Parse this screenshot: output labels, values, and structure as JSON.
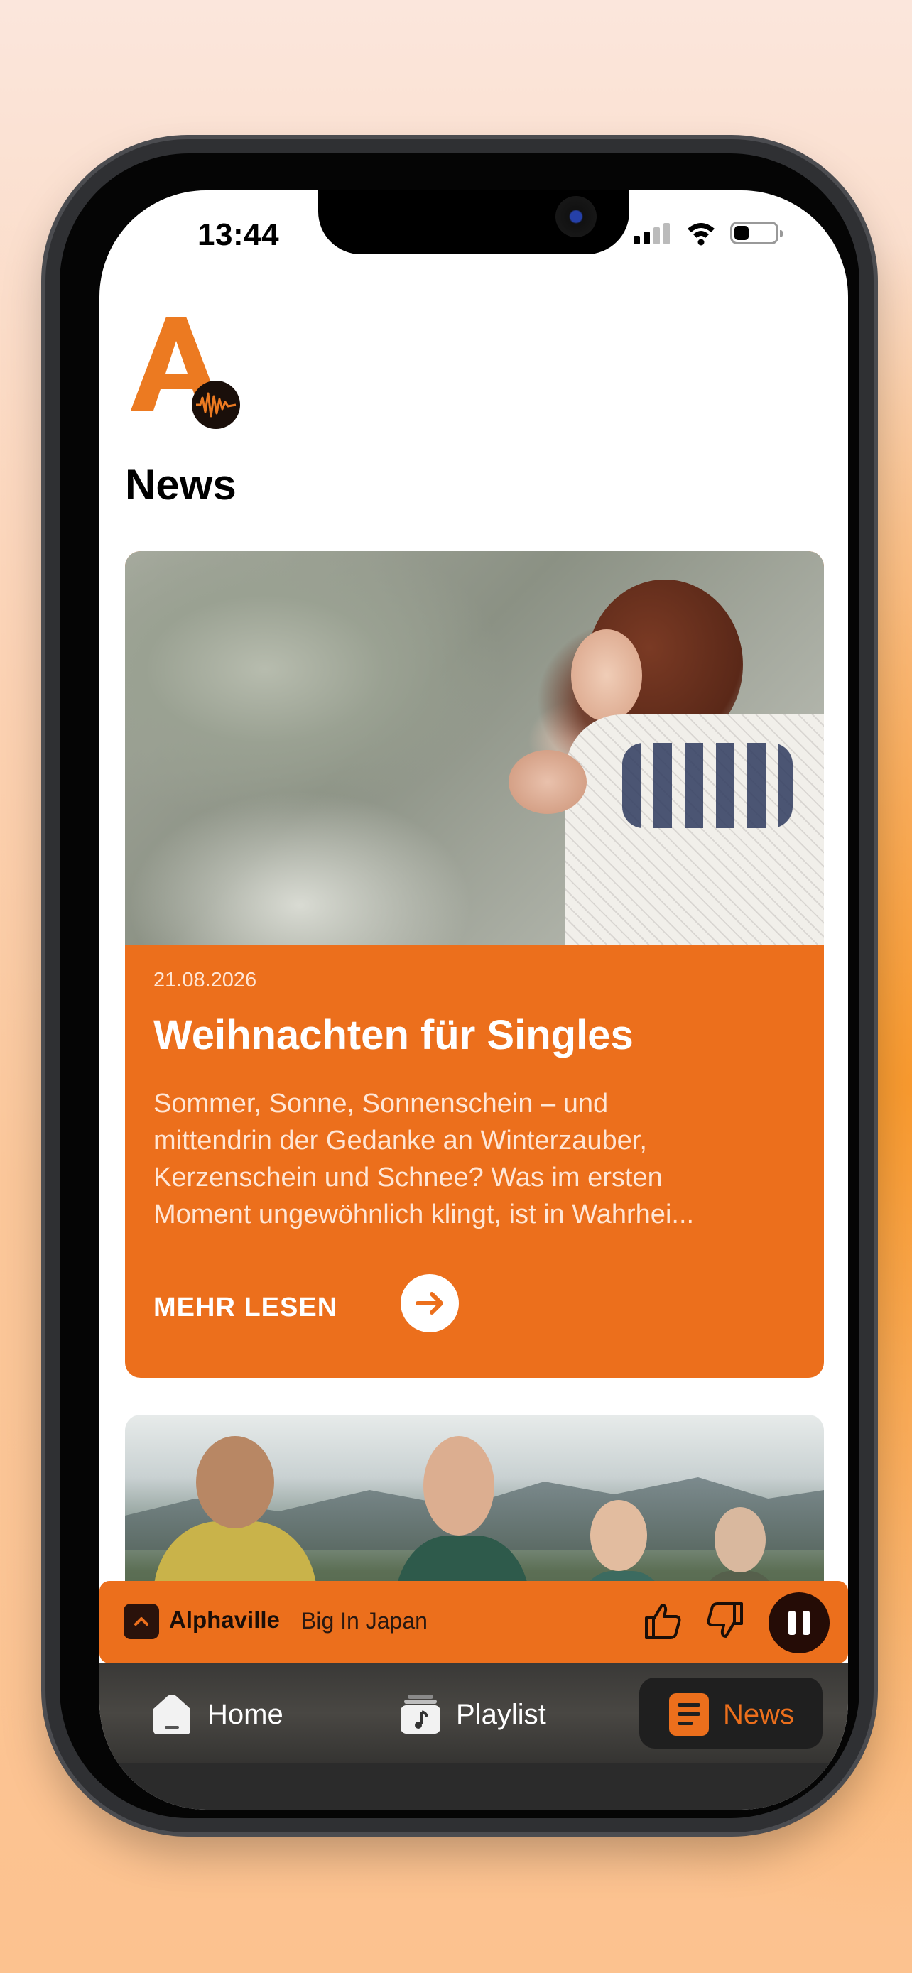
{
  "status_bar": {
    "time": "13:44"
  },
  "page": {
    "title": "News"
  },
  "news": [
    {
      "date": "21.08.2026",
      "title": "Weihnachten für Singles",
      "excerpt_lines": [
        "Sommer, Sonne, Sonnenschein – und",
        "mittendrin der Gedanke an Winterzauber,",
        "Kerzenschein und Schnee? Was im ersten",
        "Moment ungewöhnlich klingt, ist in Wahrhei..."
      ],
      "more_label": "MEHR LESEN"
    }
  ],
  "player": {
    "artist": "Alphaville",
    "song": "Big In Japan"
  },
  "tabs": [
    {
      "label": "Home",
      "icon": "home-icon"
    },
    {
      "label": "Playlist",
      "icon": "playlist-icon"
    },
    {
      "label": "News",
      "icon": "news-icon",
      "active": true
    }
  ],
  "colors": {
    "accent": "#ec6f1c",
    "dark": "#250c06"
  }
}
